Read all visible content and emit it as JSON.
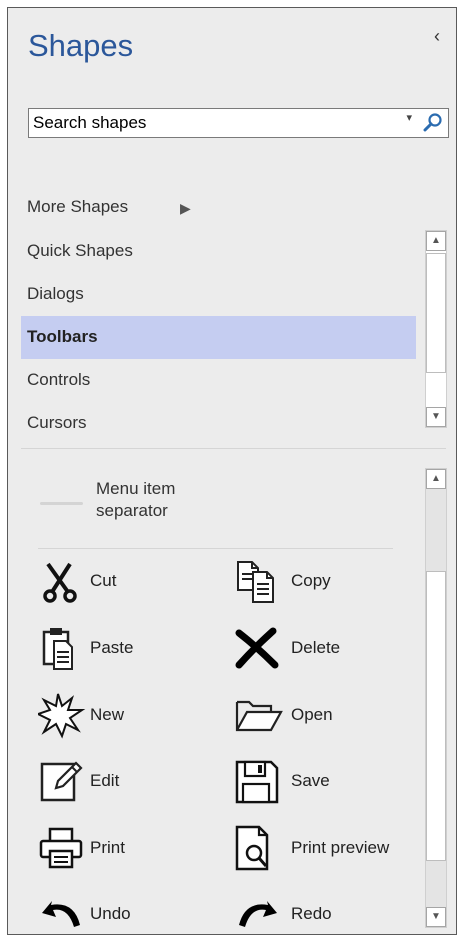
{
  "panel": {
    "title": "Shapes",
    "collapse_glyph": "‹"
  },
  "search": {
    "value": "Search shapes",
    "caret": "▾"
  },
  "more_shapes": {
    "label": "More Shapes",
    "arrow": "▶"
  },
  "stencils": [
    {
      "label": "Quick Shapes"
    },
    {
      "label": "Dialogs"
    },
    {
      "label": "Toolbars",
      "selected": true
    },
    {
      "label": "Controls"
    },
    {
      "label": "Cursors"
    }
  ],
  "separator_item": {
    "line1": "Menu item",
    "line2": "separator"
  },
  "shapes": [
    {
      "label": "Cut",
      "icon": "scissors-icon"
    },
    {
      "label": "Copy",
      "icon": "copy-icon"
    },
    {
      "label": "Paste",
      "icon": "paste-icon"
    },
    {
      "label": "Delete",
      "icon": "delete-x-icon"
    },
    {
      "label": "New",
      "icon": "new-star-icon"
    },
    {
      "label": "Open",
      "icon": "open-folder-icon"
    },
    {
      "label": "Edit",
      "icon": "edit-pencil-icon"
    },
    {
      "label": "Save",
      "icon": "save-floppy-icon"
    },
    {
      "label": "Print",
      "icon": "printer-icon"
    },
    {
      "label": "Print preview",
      "icon": "print-preview-icon"
    },
    {
      "label": "Undo",
      "icon": "undo-icon"
    },
    {
      "label": "Redo",
      "icon": "redo-icon"
    }
  ],
  "colors": {
    "title": "#2b579a",
    "selected_row": "#c5cdf1",
    "panel_bg": "#ececec"
  }
}
